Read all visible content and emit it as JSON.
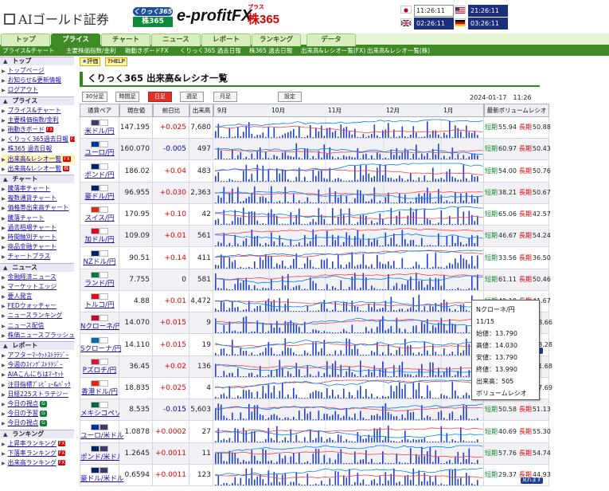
{
  "brand": {
    "company": "AIゴールド証券",
    "kurikku_top": "くりっく365",
    "kurikku_bottom": "株365",
    "efx": "e-profitFX",
    "kabu_plus": "プラス",
    "kabu": "株365"
  },
  "clocks": [
    {
      "flag": "jp",
      "time": "11:26:11"
    },
    {
      "flag": "us",
      "time": "21:26:11"
    },
    {
      "flag": "uk",
      "time": "02:26:11"
    },
    {
      "flag": "de",
      "time": "03:26:11"
    }
  ],
  "nav": {
    "tabs": [
      "トップ",
      "プライス",
      "チャート",
      "ニュース",
      "レポート",
      "ランキング",
      "データ"
    ],
    "active": "プライス",
    "sub": [
      "プライス&チャート",
      "主要株価指数/金利",
      "砲動きボードFX",
      "くりっく365 過去日報",
      "株365 過去日報",
      "出来高&レシオ一覧(FX)",
      "出来高&レシオ一覧(株)"
    ]
  },
  "sidebar": {
    "sections": [
      {
        "title": "トップ",
        "items": [
          {
            "label": "トップページ"
          },
          {
            "label": "お知らせ&更新情報"
          },
          {
            "label": "ログアウト"
          }
        ]
      },
      {
        "title": "プライス",
        "items": [
          {
            "label": "プライス&チャート"
          },
          {
            "label": "主要株価指数/金利"
          },
          {
            "label": "砲動きボード",
            "badge": "FX"
          },
          {
            "label": "くりっく365過去日報",
            "badge": "FX"
          },
          {
            "label": "株365 過去日報"
          },
          {
            "label": "出来高&レシオ一覧",
            "badge": "FX"
          },
          {
            "label": "出来高&レシオ一覧",
            "badge": "株"
          }
        ]
      },
      {
        "title": "チャート",
        "items": [
          {
            "label": "騰落率チャート"
          },
          {
            "label": "複数通貨チャート"
          },
          {
            "label": "価格帯出来高チャート"
          },
          {
            "label": "騰落チャート"
          },
          {
            "label": "過去相場チャート"
          },
          {
            "label": "時間軸別チャート"
          },
          {
            "label": "商品金融チャート"
          },
          {
            "label": "チャートプラス"
          }
        ]
      },
      {
        "title": "ニュース",
        "items": [
          {
            "label": "金融経済ニュース"
          },
          {
            "label": "マーケットエッジ"
          },
          {
            "label": "要人発言"
          },
          {
            "label": "FEDウォッチャー"
          },
          {
            "label": "ニュースランキング"
          },
          {
            "label": "ニュース配信"
          },
          {
            "label": "株価ニュースフラッシュ"
          }
        ]
      },
      {
        "title": "レポート",
        "items": [
          {
            "label": "アフターﾏｰｹｯﾄｽﾄﾗﾃｼﾞｰ"
          },
          {
            "label": "今週のｽｲﾝｸﾞｽﾄﾗﾃｼﾞｰ"
          },
          {
            "label": "AIAこんにちはﾏｰｹｯﾄ"
          },
          {
            "label": "注目指標ﾌﾟﾚﾋﾞｭｰ&ﾊﾞｯｸ"
          },
          {
            "label": "日経225ストラテジー"
          },
          {
            "label": "今日の視点",
            "badge": "G"
          },
          {
            "label": "今日の予習",
            "badge": "G"
          },
          {
            "label": "今日の視点",
            "badge": "G"
          }
        ]
      },
      {
        "title": "ランキング",
        "items": [
          {
            "label": "上昇率ランキング",
            "badge": "FX"
          },
          {
            "label": "下落率ランキング",
            "badge": "FX"
          },
          {
            "label": "出来高ランキング",
            "badge": "FX"
          }
        ]
      }
    ]
  },
  "toolbar": {
    "btn_help_top": "評価",
    "btn_help": "HELP"
  },
  "page": {
    "title": "くりっく365 出来高&レシオ一覧",
    "periods": [
      "30分足",
      "時間足",
      "日足",
      "週足",
      "月足"
    ],
    "active_period": "日足",
    "settings": "設定",
    "timestamp": "2024-01-17　11:26"
  },
  "table": {
    "headers": {
      "pair": "通貨ペア",
      "price": "現在値",
      "change": "前日比",
      "volume": "出来高",
      "ratio": "最新ボリュームレシオ"
    },
    "months": [
      "9月",
      "10月",
      "11月",
      "12月",
      "1月"
    ],
    "short_label": "短期",
    "long_label": "長期",
    "rows": [
      {
        "pair": "米ドル/円",
        "flags": [
          "#3c3b6e",
          "#ffffff"
        ],
        "price": "147.195",
        "change": "+0.025",
        "volume": "7,680",
        "short": "55.94",
        "long": "50.88"
      },
      {
        "pair": "ユーロ/円",
        "flags": [
          "#003399",
          "#ffffff"
        ],
        "price": "160.070",
        "change": "-0.005",
        "volume": "497",
        "short": "60.97",
        "long": "50.43"
      },
      {
        "pair": "ポンド/円",
        "flags": [
          "#012169",
          "#ffffff"
        ],
        "price": "186.02",
        "change": "+0.04",
        "volume": "483",
        "short": "54.00",
        "long": "50.76"
      },
      {
        "pair": "豪ドル/円",
        "flags": [
          "#012169",
          "#ffffff"
        ],
        "price": "96.955",
        "change": "+0.030",
        "volume": "2,363",
        "short": "38.21",
        "long": "50.67"
      },
      {
        "pair": "スイス/円",
        "flags": [
          "#d52b1e",
          "#ffffff"
        ],
        "price": "170.95",
        "change": "+0.10",
        "volume": "42",
        "short": "65.06",
        "long": "42.57"
      },
      {
        "pair": "加ドル/円",
        "flags": [
          "#d80621",
          "#ffffff"
        ],
        "price": "109.09",
        "change": "+0.01",
        "volume": "561",
        "short": "46.67",
        "long": "54.24"
      },
      {
        "pair": "NZドル/円",
        "flags": [
          "#012169",
          "#ffffff"
        ],
        "price": "90.51",
        "change": "+0.14",
        "volume": "411",
        "short": "33.56",
        "long": "36.50"
      },
      {
        "pair": "ランド/円",
        "flags": [
          "#007a4d",
          "#ffffff"
        ],
        "price": "7.755",
        "change": "0",
        "volume": "581",
        "short": "61.11",
        "long": "50.46"
      },
      {
        "pair": "トルコ/円",
        "flags": [
          "#e30a17",
          "#ffffff"
        ],
        "price": "4.88",
        "change": "+0.01",
        "volume": "4,472",
        "short": "49.10",
        "long": "41.67"
      },
      {
        "pair": "Nクローネ/円",
        "flags": [
          "#ba0c2f",
          "#ffffff"
        ],
        "price": "14.070",
        "change": "+0.015",
        "volume": "9",
        "short": "",
        "long": "58.66"
      },
      {
        "pair": "Sクローナ/円",
        "flags": [
          "#006aa7",
          "#ffffff"
        ],
        "price": "14.110",
        "change": "+0.015",
        "volume": "19",
        "short": "",
        "long": "18.28",
        "badge": "見れます"
      },
      {
        "pair": "Pズロチ/円",
        "flags": [
          "#dc143c",
          "#ffffff"
        ],
        "price": "36.45",
        "change": "+0.02",
        "volume": "136",
        "short": "",
        "long": "41.68"
      },
      {
        "pair": "香港ドル/円",
        "flags": [
          "#de2910",
          "#ffffff"
        ],
        "price": "18.835",
        "change": "+0.025",
        "volume": "4",
        "short": "",
        "long": "57.69"
      },
      {
        "pair": "メキシコペソ/円",
        "flags": [
          "#006847",
          "#ffffff"
        ],
        "price": "8.535",
        "change": "-0.015",
        "volume": "5,603",
        "short": "50.58",
        "long": "51.13"
      },
      {
        "pair": "ユーロ/米ドル",
        "flags": [
          "#003399",
          "#3c3b6e"
        ],
        "price": "1.0878",
        "change": "+0.0002",
        "volume": "27",
        "short": "40.69",
        "long": "55.30"
      },
      {
        "pair": "ポンド/米ドル",
        "flags": [
          "#012169",
          "#3c3b6e"
        ],
        "price": "1.2645",
        "change": "+0.0011",
        "volume": "11",
        "short": "57.76",
        "long": "54.74"
      },
      {
        "pair": "豪ドル/米ドル",
        "flags": [
          "#012169",
          "#3c3b6e"
        ],
        "price": "0.6594",
        "change": "+0.0011",
        "volume": "123",
        "short": "29.37",
        "long": "44.93",
        "badge": "見れます"
      }
    ]
  },
  "tooltip": {
    "lines": [
      "Nクローネ/円",
      "11/15",
      "始値：13.790",
      "高値：14.030",
      "安値：13.790",
      "終値：13.990",
      "出来高：505",
      "ボリュームレシオ"
    ]
  },
  "colors": {
    "green": "#3f8a24",
    "bar": "#1f3fd4",
    "short_line": "#0080ff",
    "long_line": "#ff4040"
  }
}
